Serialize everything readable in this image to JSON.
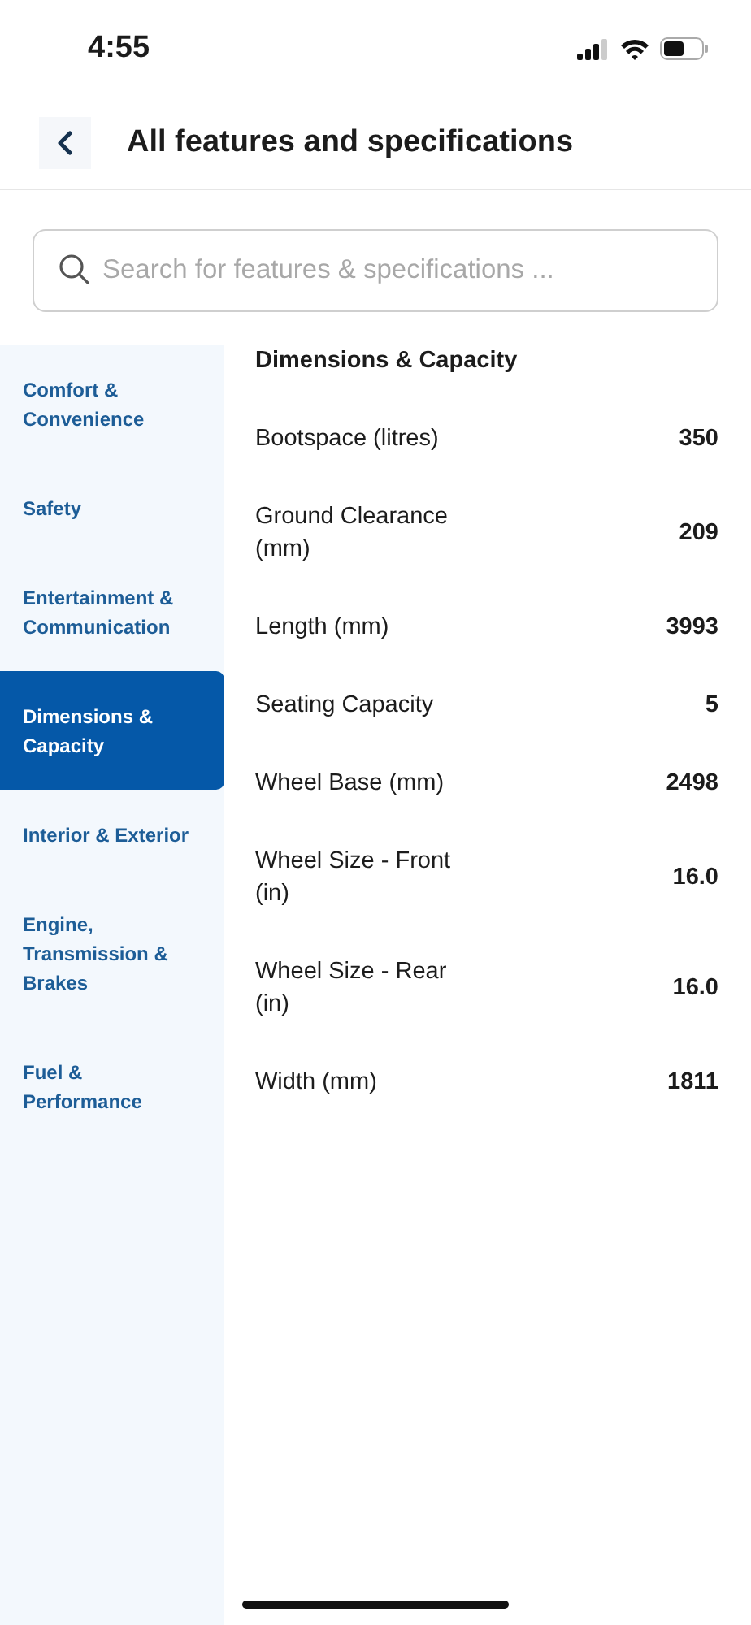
{
  "status_bar": {
    "time": "4:55"
  },
  "header": {
    "title": "All features and specifications"
  },
  "search": {
    "placeholder": "Search for features & specifications ..."
  },
  "sidebar": {
    "items": [
      {
        "label": "Comfort & Convenience",
        "selected": false
      },
      {
        "label": "Safety",
        "selected": false
      },
      {
        "label": "Entertainment & Communication",
        "selected": false
      },
      {
        "label": "Dimensions & Capacity",
        "selected": true
      },
      {
        "label": "Interior & Exterior",
        "selected": false
      },
      {
        "label": "Engine, Transmission & Brakes",
        "selected": false
      },
      {
        "label": "Fuel & Performance",
        "selected": false
      }
    ]
  },
  "section": {
    "title": "Dimensions & Capacity",
    "rows": [
      {
        "name": "Bootspace (litres)",
        "value": "350"
      },
      {
        "name": "Ground Clearance (mm)",
        "value": "209"
      },
      {
        "name": "Length (mm)",
        "value": "3993"
      },
      {
        "name": "Seating Capacity",
        "value": "5"
      },
      {
        "name": "Wheel Base (mm)",
        "value": "2498"
      },
      {
        "name": "Wheel Size - Front (in)",
        "value": "16.0"
      },
      {
        "name": "Wheel Size - Rear (in)",
        "value": "16.0"
      },
      {
        "name": "Width (mm)",
        "value": "1811"
      }
    ]
  }
}
